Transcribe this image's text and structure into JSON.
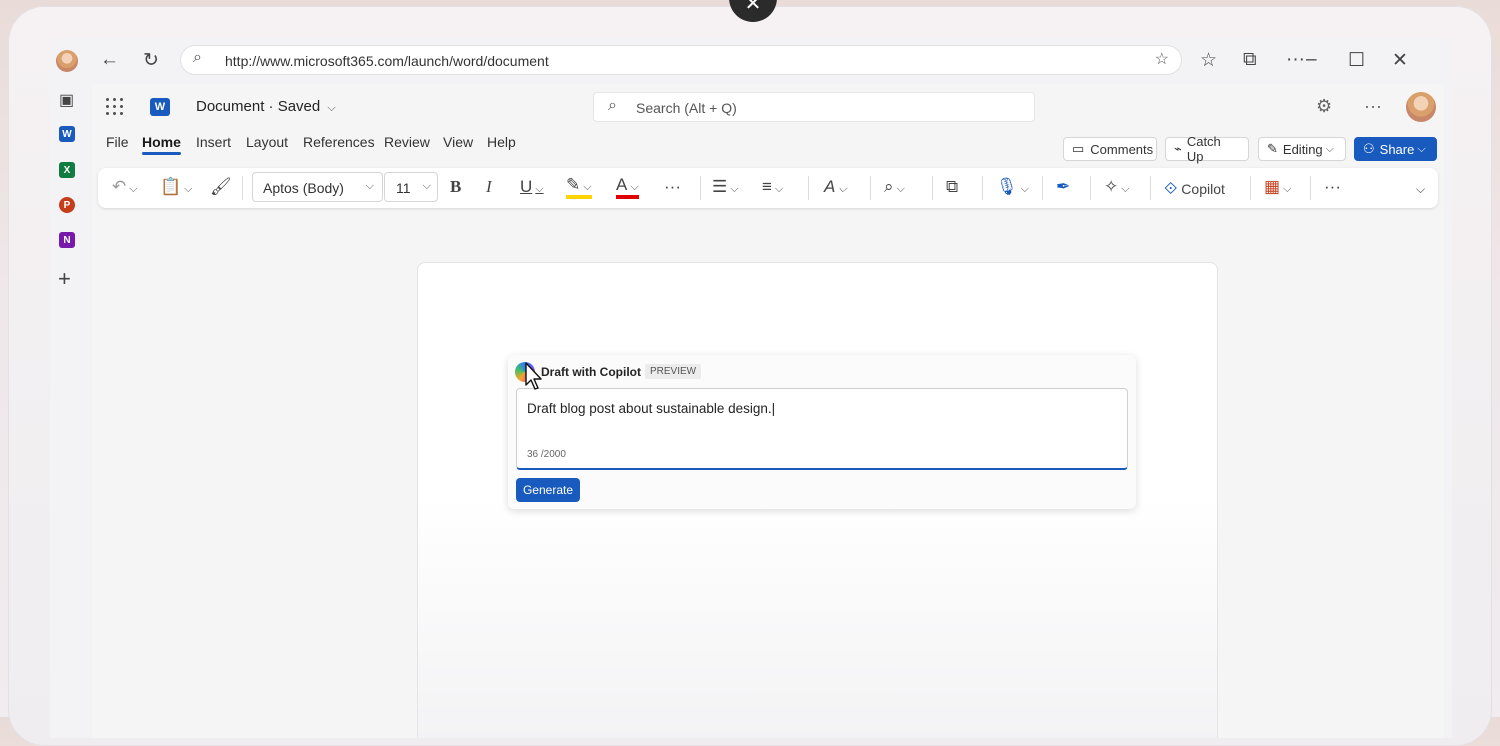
{
  "browser": {
    "url": "http://www.microsoft365.com/launch/word/document"
  },
  "apps": [
    {
      "name": "Word",
      "letter": "W",
      "color": "#185abd"
    },
    {
      "name": "Excel",
      "letter": "X",
      "color": "#107c41"
    },
    {
      "name": "PowerPoint",
      "letter": "P",
      "color": "#c43e1c"
    },
    {
      "name": "OneNote",
      "letter": "N",
      "color": "#7719aa"
    }
  ],
  "header": {
    "doc_title": "Document · Saved",
    "search_placeholder": "Search (Alt + Q)"
  },
  "tabs": [
    "File",
    "Home",
    "Insert",
    "Layout",
    "References",
    "Review",
    "View",
    "Help"
  ],
  "active_tab": "Home",
  "actions": {
    "comments": "Comments",
    "catch_up": "Catch Up",
    "editing": "Editing",
    "share": "Share"
  },
  "ribbon": {
    "font": "Aptos (Body)",
    "size": "11",
    "copilot": "Copilot"
  },
  "copilot_panel": {
    "title": "Draft with Copilot",
    "badge": "PREVIEW",
    "prompt_text": "Draft blog post about sustainable design.|",
    "char_count": "36 /2000",
    "generate": "Generate"
  },
  "colors": {
    "accent": "#185abd",
    "highlight": "#ffd400",
    "font_color": "#e00000"
  }
}
